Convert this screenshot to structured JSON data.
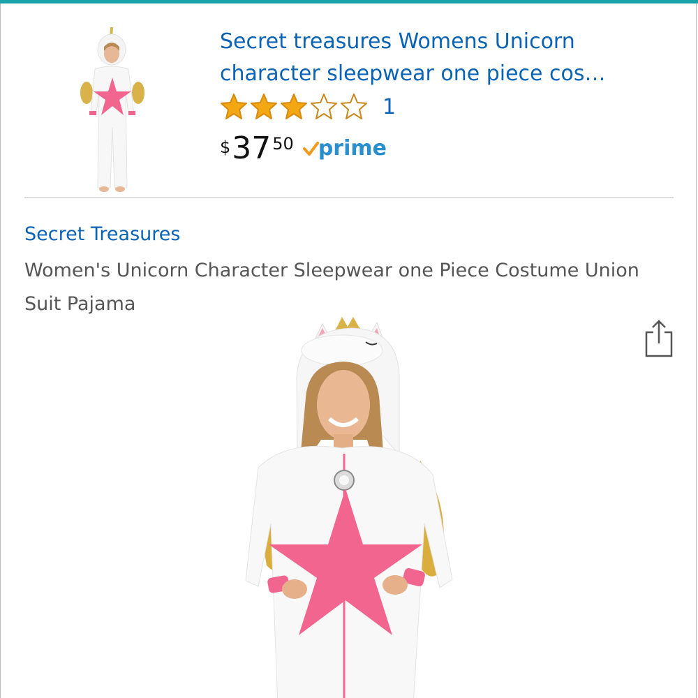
{
  "product": {
    "title": "Secret treasures Womens Unicorn character sleepwear one piece cos…",
    "rating_stars": 3,
    "rating_max": 5,
    "review_count": "1",
    "price": {
      "currency": "$",
      "whole": "37",
      "fraction": "50"
    },
    "prime_label": "prime",
    "brand": "Secret Treasures",
    "full_name": "Women's Unicorn Character Sleepwear one Piece Costume Union Suit Pajama"
  },
  "colors": {
    "accent_bar": "#1aa3a7",
    "link": "#0b63b5",
    "star_fill": "#f3a712",
    "prime_blue": "#2a8fcf",
    "prime_check": "#f39a1e",
    "costume_star": "#f2658f"
  },
  "icons": {
    "share": "share-icon",
    "star_full": "star-filled-icon",
    "star_empty": "star-empty-icon",
    "prime_check": "prime-check-icon"
  }
}
